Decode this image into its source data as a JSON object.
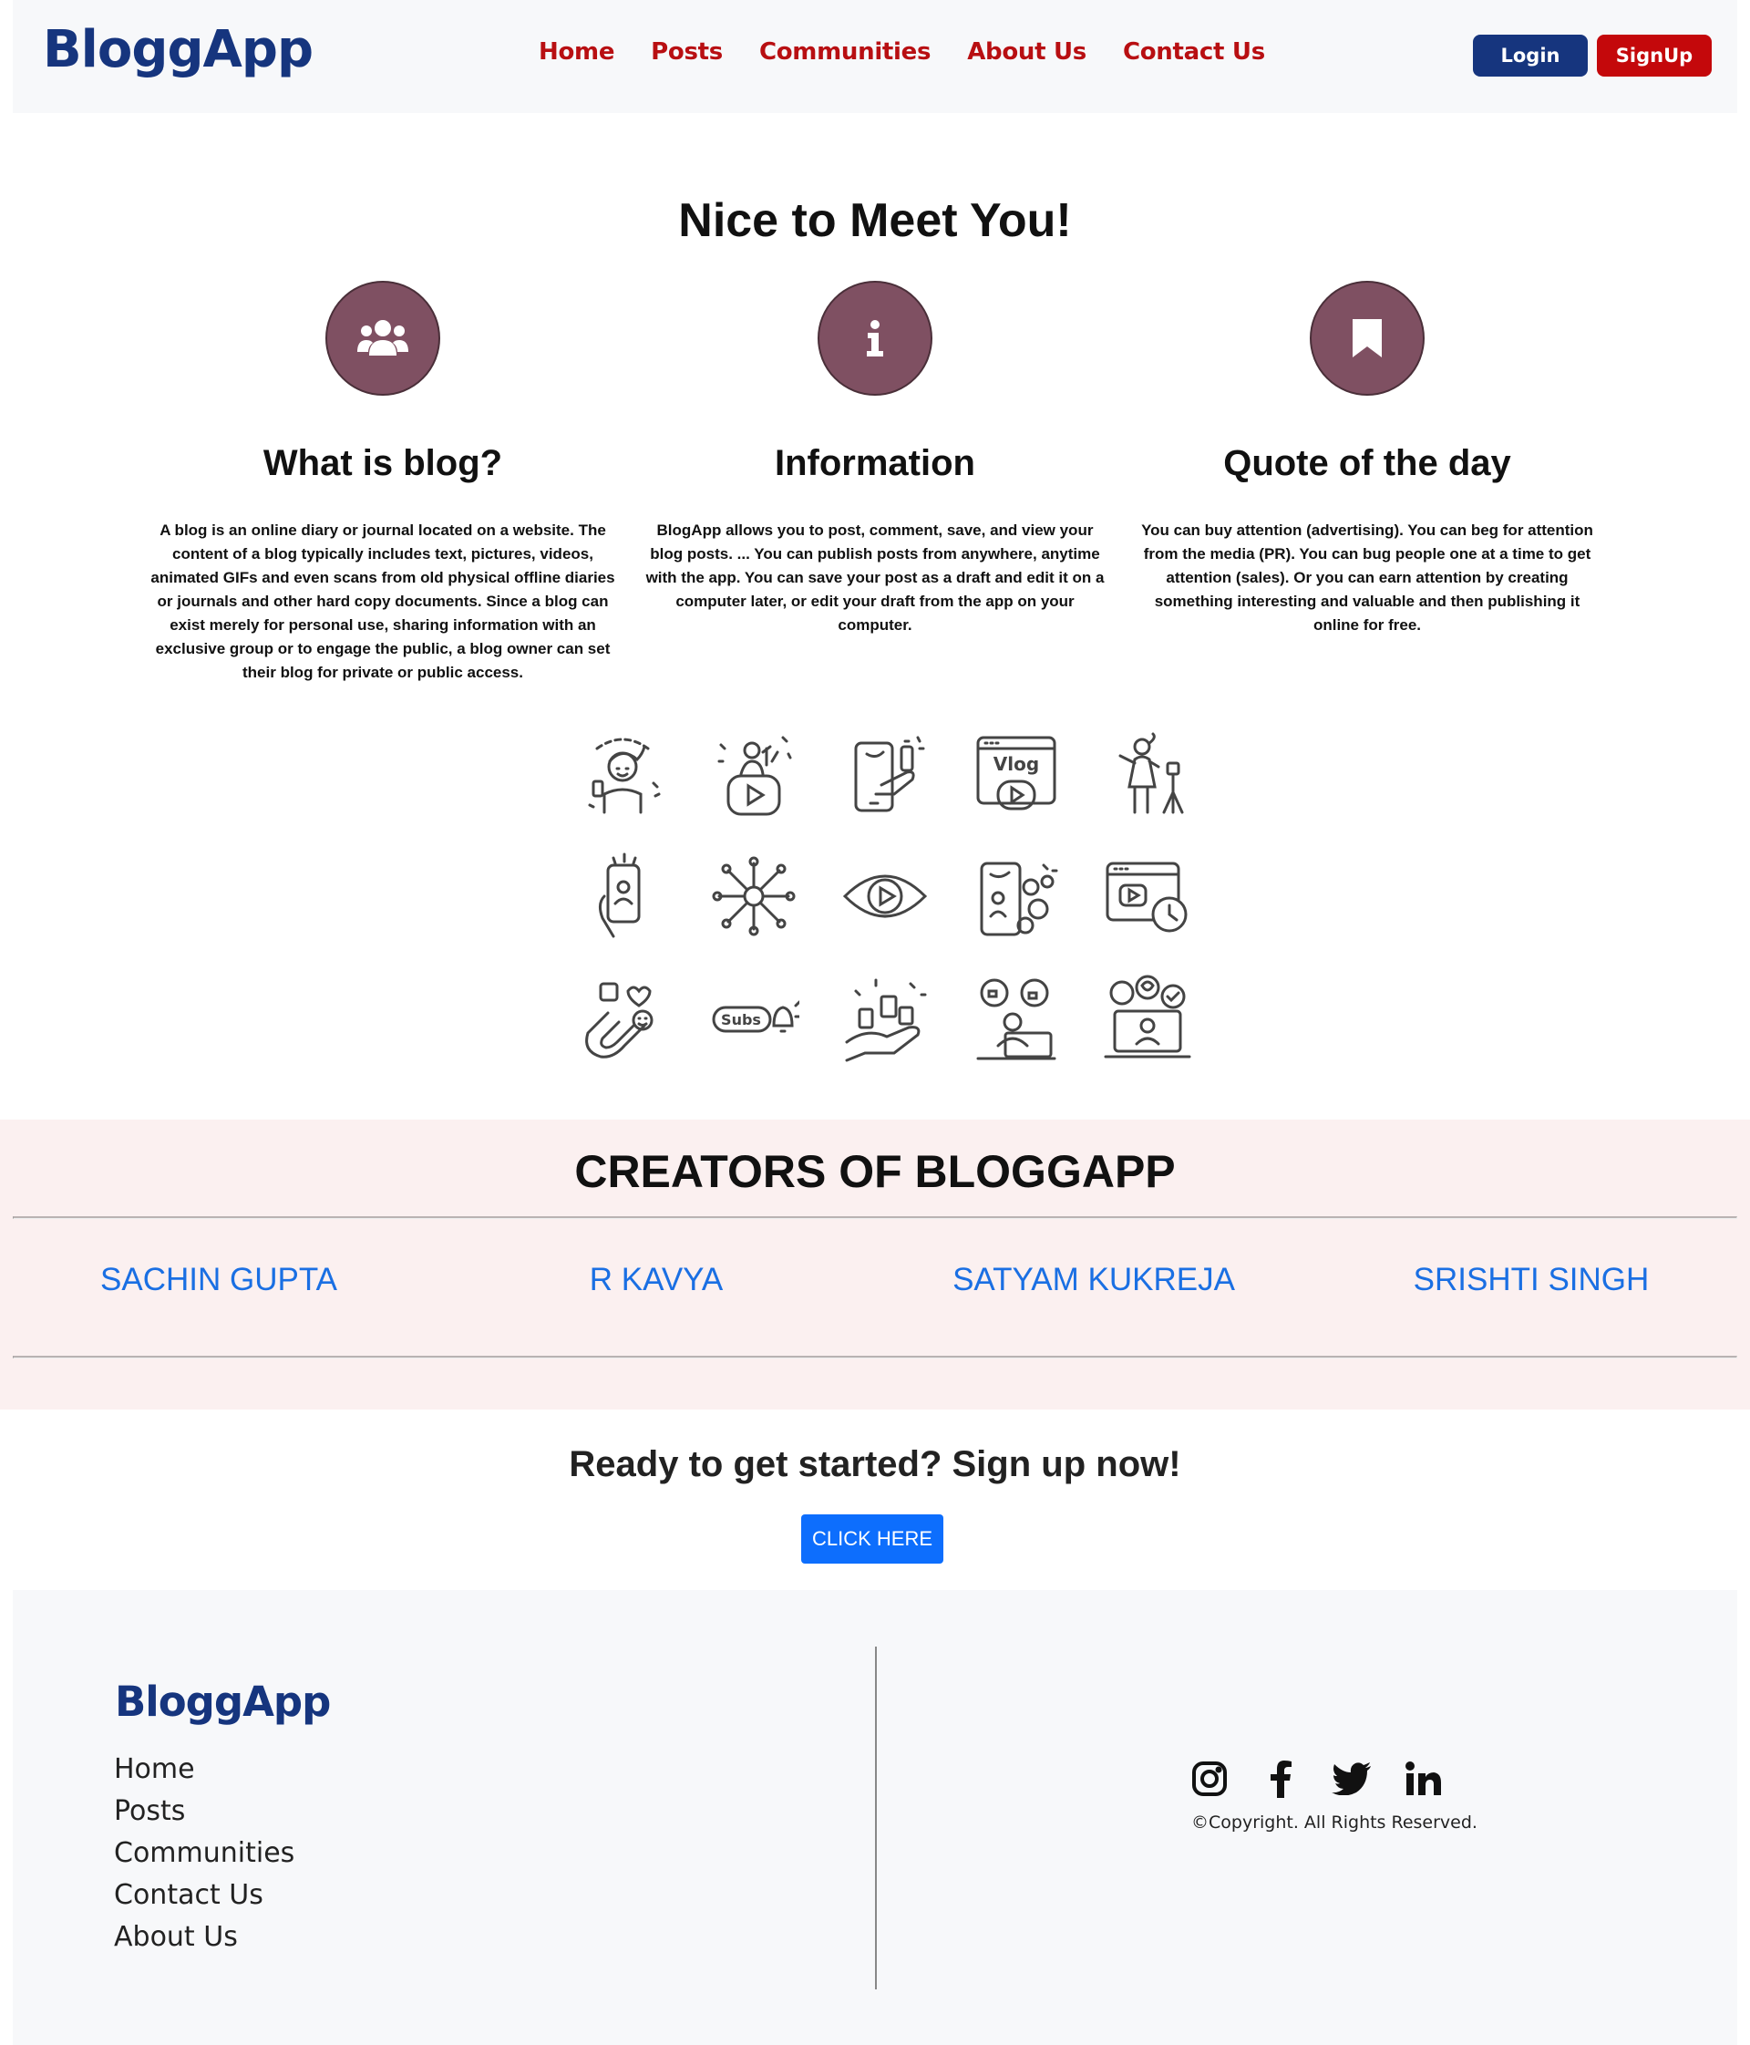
{
  "navbar": {
    "brand": "BloggApp",
    "links": [
      "Home",
      "Posts",
      "Communities",
      "About Us",
      "Contact Us"
    ],
    "login_label": "Login",
    "signup_label": "SignUp"
  },
  "features": {
    "heading": "Nice to Meet You!",
    "items": [
      {
        "icon": "users-icon",
        "title": "What is blog?",
        "text": "A blog is an online diary or journal located on a website. The content of a blog typically includes text, pictures, videos, animated GIFs and even scans from old physical offline diaries or journals and other hard copy documents. Since a blog can exist merely for personal use, sharing information with an exclusive group or to engage the public, a blog owner can set their blog for private or public access."
      },
      {
        "icon": "info-icon",
        "title": "Information",
        "text": "BlogApp allows you to post, comment, save, and view your blog posts. ... You can publish posts from anywhere, anytime with the app. You can save your post as a draft and edit it on a computer later, or edit your draft from the app on your computer."
      },
      {
        "icon": "bookmark-icon",
        "title": "Quote of the day",
        "text": "You can buy attention (advertising). You can beg for attention from the media (PR). You can bug people one at a time to get attention (sales). Or you can earn attention by creating something interesting and valuable and then publishing it online for free."
      }
    ]
  },
  "illustration": {
    "vlog_label": "Vlog",
    "subs_label": "Subs"
  },
  "creators": {
    "heading": "CREATORS OF BLOGGAPP",
    "names": [
      "SACHIN GUPTA",
      "R KAVYA",
      "SATYAM KUKREJA",
      "SRISHTI SINGH"
    ]
  },
  "cta": {
    "heading": "Ready to get started? Sign up now!",
    "button_label": "CLICK HERE"
  },
  "footer": {
    "brand": "BloggApp",
    "links": [
      "Home",
      "Posts",
      "Communities",
      "Contact Us",
      "About Us"
    ],
    "social_icons": [
      "instagram-icon",
      "facebook-icon",
      "twitter-icon",
      "linkedin-icon"
    ],
    "copyright": "©Copyright. All Rights Reserved."
  },
  "colors": {
    "brand": "#16357e",
    "nav_link": "#b80f12",
    "signup": "#c4080b",
    "feature_circle": "#7f5062",
    "creators_bg": "#fbf0f0",
    "creator_name": "#1a6fe3",
    "cta_button": "#0d6efd"
  }
}
